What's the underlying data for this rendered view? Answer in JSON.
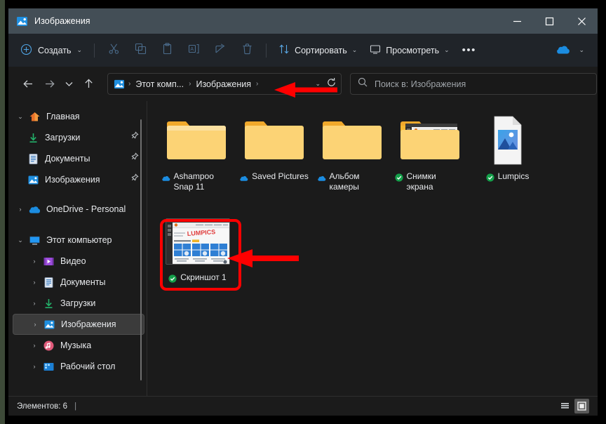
{
  "window": {
    "title": "Изображения",
    "title_icon": "pictures-icon",
    "minimize": "—",
    "maximize": "□",
    "close": "✕"
  },
  "toolbar": {
    "new_label": "Создать",
    "new_icon": "plus-circle-icon",
    "cut_icon": "scissors-icon",
    "copy_icon": "copy-icon",
    "paste_icon": "paste-icon",
    "rename_icon": "rename-icon",
    "share_icon": "share-icon",
    "delete_icon": "trash-icon",
    "sort_label": "Сортировать",
    "sort_icon": "sort-arrows-icon",
    "view_label": "Просмотреть",
    "view_icon": "monitor-icon",
    "more_label": "•••",
    "onedrive_icon": "cloud-icon"
  },
  "nav": {
    "back_icon": "arrow-left-icon",
    "forward_icon": "arrow-right-icon",
    "recent_icon": "chevron-down-icon",
    "up_icon": "arrow-up-icon",
    "breadcrumb": [
      {
        "label": "Этот комп...",
        "icon": "pictures-icon"
      },
      {
        "label": "Изображения",
        "icon": ""
      }
    ],
    "breadcrumb_sep": "›",
    "refresh_icon": "refresh-icon",
    "address_dropdown_icon": "chevron-down-icon"
  },
  "search": {
    "placeholder": "Поиск в: Изображения",
    "icon": "search-icon"
  },
  "sidebar": {
    "items": [
      {
        "label": "Главная",
        "icon": "home-icon",
        "expander": "v",
        "indent": false,
        "pinned": false,
        "selected": false
      },
      {
        "label": "Загрузки",
        "icon": "downloads-icon",
        "expander": "",
        "indent": true,
        "pinned": true,
        "selected": false
      },
      {
        "label": "Документы",
        "icon": "documents-icon",
        "expander": "",
        "indent": true,
        "pinned": true,
        "selected": false
      },
      {
        "label": "Изображения",
        "icon": "pictures-icon",
        "expander": "",
        "indent": true,
        "pinned": true,
        "selected": false
      },
      {
        "label": "OneDrive - Personal",
        "icon": "cloud-icon",
        "expander": ">",
        "indent": false,
        "pinned": false,
        "selected": false
      },
      {
        "label": "Этот компьютер",
        "icon": "pc-icon",
        "expander": "v",
        "indent": false,
        "pinned": false,
        "selected": false
      },
      {
        "label": "Видео",
        "icon": "video-icon",
        "expander": ">",
        "indent": true,
        "pinned": false,
        "selected": false
      },
      {
        "label": "Документы",
        "icon": "documents-icon",
        "expander": ">",
        "indent": true,
        "pinned": false,
        "selected": false
      },
      {
        "label": "Загрузки",
        "icon": "downloads-icon",
        "expander": ">",
        "indent": true,
        "pinned": false,
        "selected": false
      },
      {
        "label": "Изображения",
        "icon": "pictures-icon",
        "expander": ">",
        "indent": true,
        "pinned": false,
        "selected": true
      },
      {
        "label": "Музыка",
        "icon": "music-icon",
        "expander": ">",
        "indent": true,
        "pinned": false,
        "selected": false
      },
      {
        "label": "Рабочий стол",
        "icon": "desktop-icon",
        "expander": ">",
        "indent": true,
        "pinned": false,
        "selected": false
      }
    ]
  },
  "files": [
    {
      "name": "Ashampoo Snap 11",
      "type": "folder",
      "badge": "cloud",
      "selected": false
    },
    {
      "name": "Saved Pictures",
      "type": "folder",
      "badge": "cloud",
      "selected": false
    },
    {
      "name": "Альбом камеры",
      "type": "folder",
      "badge": "cloud",
      "selected": false
    },
    {
      "name": "Снимки экрана",
      "type": "folder-preview",
      "badge": "check",
      "selected": false
    },
    {
      "name": "Lumpics",
      "type": "image-file",
      "badge": "check",
      "selected": false
    },
    {
      "name": "Скриншот 1",
      "type": "image-thumb",
      "badge": "check",
      "selected": true
    }
  ],
  "status": {
    "items_label": "Элементов: 6",
    "separator": "|",
    "list_view_icon": "list-view-icon",
    "tiles_view_icon": "tiles-view-icon"
  },
  "annotations": {
    "arrow_color": "#ff0000",
    "rect_color": "#ff0000",
    "arrow_breadcrumb": "arrow-pointing-left-at-address-bar",
    "arrow_item": "arrow-pointing-left-at-screenshot-file",
    "rect_item": "highlight-rect-around-screenshot-file"
  },
  "colors": {
    "titlebar": "#434e56",
    "toolbar": "#202429",
    "background": "#1b1b1b",
    "folder": "#f5c342",
    "accent_blue": "#0a84d8",
    "green_check": "#14a04a",
    "edge_strip": "#3d4a38"
  }
}
